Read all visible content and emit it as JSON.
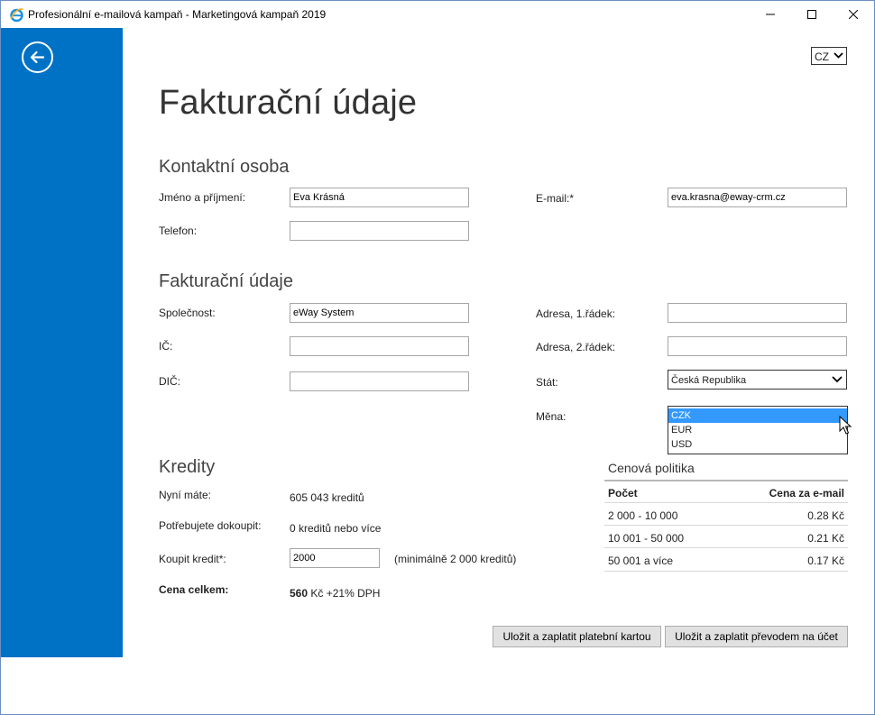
{
  "window": {
    "title": "Profesionální e-mailová kampaň - Marketingová kampaň 2019"
  },
  "language_select": {
    "value": "CZ"
  },
  "page_title": "Fakturační údaje",
  "contact": {
    "heading": "Kontaktní osoba",
    "name_label": "Jméno a příjmení:",
    "name_value": "Eva Krásná",
    "phone_label": "Telefon:",
    "phone_value": "",
    "email_label": "E-mail:*",
    "email_value": "eva.krasna@eway-crm.cz"
  },
  "billing": {
    "heading": "Fakturační údaje",
    "company_label": "Společnost:",
    "company_value": "eWay System",
    "ic_label": "IČ:",
    "ic_value": "",
    "dic_label": "DIČ:",
    "dic_value": "",
    "address1_label": "Adresa, 1.řádek:",
    "address1_value": "",
    "address2_label": "Adresa, 2.řádek:",
    "address2_value": "",
    "country_label": "Stát:",
    "country_value": "Česká Republika",
    "currency_label": "Měna:",
    "currency_options": [
      "CZK",
      "EUR",
      "USD"
    ],
    "currency_selected": "CZK"
  },
  "credits": {
    "heading": "Kredity",
    "have_label": "Nyní máte:",
    "have_value": "605 043 kreditů",
    "need_label": "Potřebujete dokoupit:",
    "need_value": "0 kreditů nebo více",
    "buy_label": "Koupit kredit*:",
    "buy_value": "2000",
    "buy_hint": "(minimálně 2 000 kreditů)",
    "total_label": "Cena celkem:",
    "total_amount": "560",
    "total_suffix": "Kč +21% DPH"
  },
  "pricing": {
    "title": "Cenová politika",
    "col_count": "Počet",
    "col_price": "Cena za e-mail",
    "rows": [
      {
        "count": "2 000 - 10 000",
        "price": "0.28 Kč"
      },
      {
        "count": "10 001 - 50 000",
        "price": "0.21 Kč"
      },
      {
        "count": "50 001 a více",
        "price": "0.17 Kč"
      }
    ]
  },
  "actions": {
    "pay_card": "Uložit a zaplatit platební kartou",
    "pay_transfer": "Uložit a zaplatit převodem na účet"
  },
  "colors": {
    "sidebar": "#0072c6",
    "selection": "#3399ff"
  },
  "icons": {
    "app": "internet-explorer-icon",
    "back": "back-arrow-icon",
    "minimize": "minimize-icon",
    "maximize": "maximize-icon",
    "close": "close-icon",
    "dropdown": "chevron-down-icon",
    "cursor": "mouse-pointer-icon"
  }
}
